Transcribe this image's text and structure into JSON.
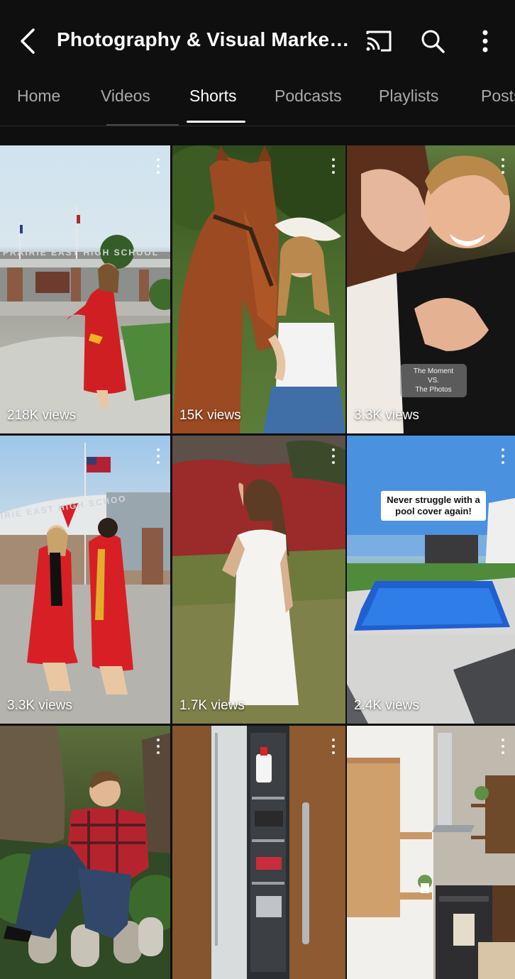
{
  "header": {
    "title": "Photography & Visual Marketi...",
    "back_icon": "back-arrow-icon",
    "cast_icon": "cast-icon",
    "search_icon": "search-icon",
    "more_icon": "more-vert-icon"
  },
  "tabs": [
    {
      "label": "Home",
      "active": false
    },
    {
      "label": "Videos",
      "active": false
    },
    {
      "label": "Shorts",
      "active": true
    },
    {
      "label": "Podcasts",
      "active": false
    },
    {
      "label": "Playlists",
      "active": false
    },
    {
      "label": "Posts",
      "active": false
    }
  ],
  "shorts": [
    {
      "views": "218K views"
    },
    {
      "views": "15K views"
    },
    {
      "views": "3.3K views",
      "overlay_text": [
        "The Moment",
        "VS.",
        "The Photos"
      ]
    },
    {
      "views": "3.3K views"
    },
    {
      "views": "1.7K views"
    },
    {
      "views": "2.4K views",
      "overlay_text": [
        "Never struggle with a",
        "pool cover again!"
      ]
    },
    {
      "views": ""
    },
    {
      "views": ""
    },
    {
      "views": ""
    }
  ],
  "signage": {
    "tile1": "PRAIRIE EAST HIGH SCHOOL",
    "tile4": "IRIE EAST HIGH SCHOO"
  },
  "colors": {
    "background": "#0f0f0f",
    "text_primary": "#ffffff",
    "text_secondary": "#aaaaaa"
  }
}
